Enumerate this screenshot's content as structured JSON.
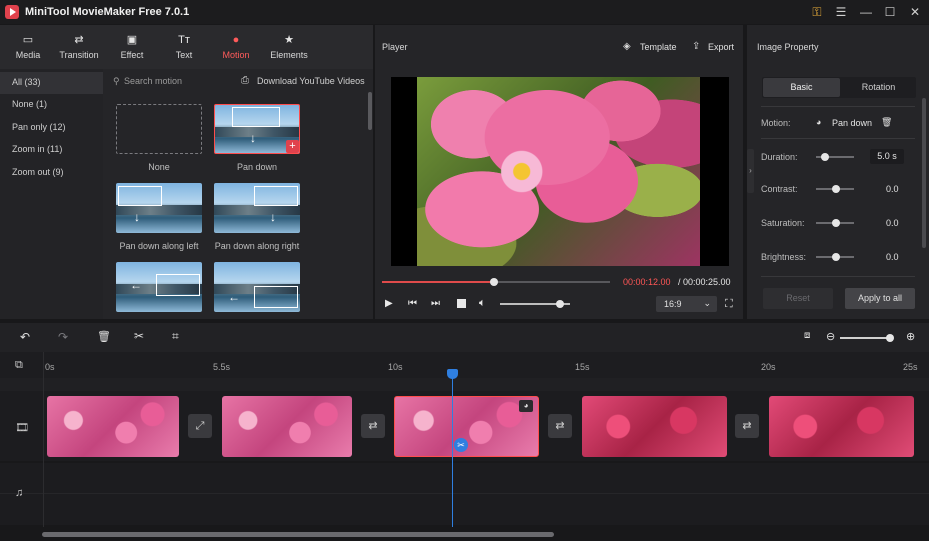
{
  "app": {
    "title": "MiniTool MovieMaker Free 7.0.1"
  },
  "nav": [
    {
      "label": "Media",
      "icon": "media-icon",
      "glyph": "▭"
    },
    {
      "label": "Transition",
      "icon": "transition-icon",
      "glyph": "⇄"
    },
    {
      "label": "Effect",
      "icon": "effect-icon",
      "glyph": "▣"
    },
    {
      "label": "Text",
      "icon": "text-icon",
      "glyph": "Tт"
    },
    {
      "label": "Motion",
      "icon": "motion-icon",
      "glyph": "●"
    },
    {
      "label": "Elements",
      "icon": "elements-icon",
      "glyph": "★"
    }
  ],
  "categories": [
    {
      "label": "All (33)"
    },
    {
      "label": "None (1)"
    },
    {
      "label": "Pan only (12)"
    },
    {
      "label": "Zoom in (11)"
    },
    {
      "label": "Zoom out (9)"
    }
  ],
  "motion": {
    "search_placeholder": "Search motion",
    "download_label": "Download YouTube Videos",
    "items": [
      {
        "label": "None"
      },
      {
        "label": "Pan down"
      },
      {
        "label": "Pan down along left"
      },
      {
        "label": "Pan down along right"
      },
      {
        "label": ""
      },
      {
        "label": ""
      }
    ]
  },
  "player": {
    "title": "Player",
    "template_label": "Template",
    "export_label": "Export",
    "current_time": "00:00:12.00",
    "total_time": "/ 00:00:25.00",
    "aspect": "16:9",
    "progress": 0.49,
    "volume": 0.85
  },
  "properties": {
    "title": "Image Property",
    "tabs": [
      "Basic",
      "Rotation"
    ],
    "motion_label": "Motion:",
    "motion_value": "Pan down",
    "duration_label": "Duration:",
    "duration_value": "5.0 s",
    "contrast_label": "Contrast:",
    "contrast_value": "0.0",
    "saturation_label": "Saturation:",
    "saturation_value": "0.0",
    "brightness_label": "Brightness:",
    "brightness_value": "0.0",
    "reset_label": "Reset",
    "apply_label": "Apply to all"
  },
  "timeline": {
    "ruler": [
      "0s",
      "5.5s",
      "10s",
      "15s",
      "20s",
      "25s"
    ]
  },
  "colors": {
    "accent": "#ff5b5b",
    "playhead": "#2f7fe0"
  }
}
